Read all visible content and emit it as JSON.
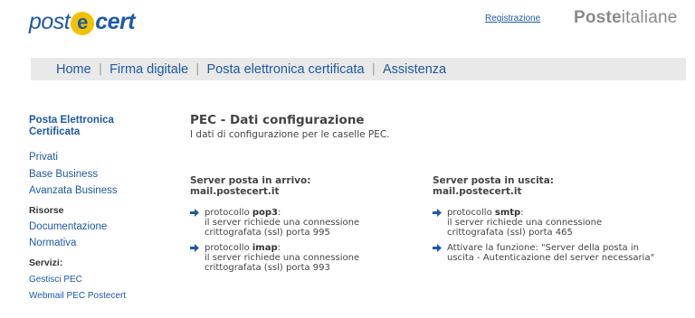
{
  "header": {
    "logo": {
      "part1": "post",
      "e_letter": "e",
      "part2": "cert"
    },
    "registration_link": "Registrazione",
    "brand": {
      "bold": "Poste",
      "light": "italiane"
    }
  },
  "nav": {
    "items": [
      "Home",
      "Firma digitale",
      "Posta elettronica certificata",
      "Assistenza"
    ],
    "separator": "|"
  },
  "sidebar": {
    "title_line1": "Posta Elettronica",
    "title_line2": "Certificata",
    "links": [
      "Privati",
      "Base Business",
      "Avanzata Business"
    ],
    "risorse_head": "Risorse",
    "risorse_links": [
      "Documentazione",
      "Normativa"
    ],
    "servizi_head": "Servizi:",
    "servizi_links": [
      "Gestisci PEC",
      "Webmail PEC Postecert"
    ]
  },
  "main": {
    "title": "PEC - Dati configurazione",
    "subtitle": "I dati di configurazione per le caselle PEC."
  },
  "incoming": {
    "label": "Server posta in arrivo:",
    "host": "mail.postecert.it",
    "items": [
      {
        "prefix": "protocollo ",
        "protocol": "pop3",
        "suffix": ":",
        "line2": "il server richiede una connessione",
        "line3": "crittografata (ssl) porta 995"
      },
      {
        "prefix": "protocollo ",
        "protocol": "imap",
        "suffix": ":",
        "line2": "il server richiede una connessione",
        "line3": "crittografata (ssl) porta 993"
      }
    ]
  },
  "outgoing": {
    "label": "Server posta in uscita:",
    "host": "mail.postecert.it",
    "items": [
      {
        "prefix": "protocollo ",
        "protocol": "smtp",
        "suffix": ":",
        "line2": "il server richiede una connessione",
        "line3": "crittografata (ssl) porta 465"
      }
    ],
    "note_line1": "Attivare la funzione: \"Server della posta in",
    "note_line2": "uscita - Autenticazione del server necessaria\""
  },
  "colors": {
    "link_blue": "#1d59a6",
    "logo_yellow": "#f2c200",
    "nav_bg": "#e9e9e9",
    "brand_gray": "#8a8a8a"
  },
  "icons": {
    "bullet": "arrow-right-icon"
  }
}
